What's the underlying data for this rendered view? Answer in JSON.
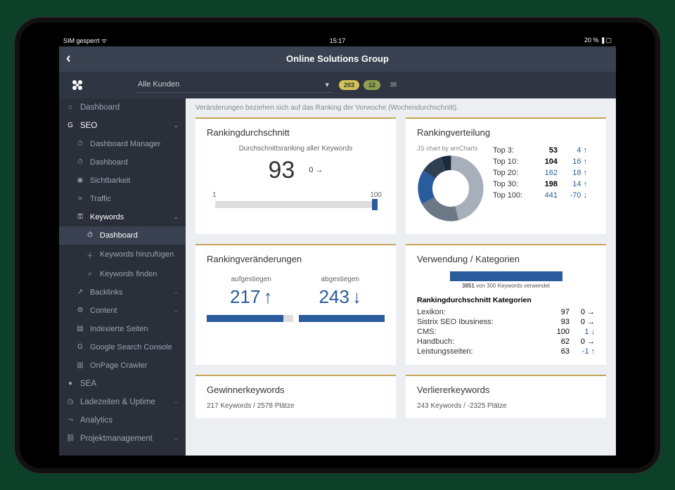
{
  "status": {
    "left": "SIM gesperrt ᯤ",
    "time": "15:17",
    "right": "20 % ❚▢"
  },
  "app_title": "Online Solutions Group",
  "customer_selector": "Alle Kunden",
  "badges": {
    "a": "203",
    "b": "12"
  },
  "sidebar": {
    "dashboard": "Dashboard",
    "seo": "SEO",
    "seo_items": {
      "dash_mgr": "Dashboard Manager",
      "dash": "Dashboard",
      "visibility": "Sichtbarkeit",
      "traffic": "Traffic",
      "keywords": "Keywords",
      "kw_dash": "Dashboard",
      "kw_add": "Keywords hinzufügen",
      "kw_find": "Keywords finden",
      "backlinks": "Backlinks",
      "content": "Content",
      "indexed": "Indexierte Seiten",
      "gsc": "Google Search Console",
      "onpage": "OnPage Crawler"
    },
    "sea": "SEA",
    "uptime": "Ladezeiten & Uptime",
    "analytics": "Analytics",
    "pm": "Projektmanagement"
  },
  "note": "Veränderungen beziehen sich auf das Ranking der Vorwoche (Wochendurchschnitt).",
  "cards": {
    "avg": {
      "title": "Rankingdurchschnitt",
      "subtitle": "Durchschnittsranking aller Keywords",
      "value": "93",
      "delta": "0 →",
      "min": "1",
      "max": "100"
    },
    "dist": {
      "title": "Rankingverteilung",
      "credit": "JS chart by amCharts",
      "rows": [
        {
          "label": "Top 3:",
          "value": "53",
          "delta": "4 ↑",
          "link": false
        },
        {
          "label": "Top 10:",
          "value": "104",
          "delta": "16 ↑",
          "link": false
        },
        {
          "label": "Top 20:",
          "value": "162",
          "delta": "18 ↑",
          "link": true
        },
        {
          "label": "Top 30:",
          "value": "198",
          "delta": "14 ↑",
          "link": false
        },
        {
          "label": "Top 100:",
          "value": "441",
          "delta": "-70 ↓",
          "link": true
        }
      ]
    },
    "changes": {
      "title": "Rankingveränderungen",
      "up_label": "aufgestiegen",
      "up_value": "217",
      "down_label": "abgestiegen",
      "down_value": "243"
    },
    "usage": {
      "title": "Verwendung / Kategorien",
      "bar_bold": "3851",
      "bar_rest": " von 300 Keywords verwendet",
      "cat_title": "Rankingdurchschnitt Kategorien",
      "rows": [
        {
          "label": "Lexikon:",
          "v": "97",
          "d": "0 →"
        },
        {
          "label": "Sistrix SEO Ibusiness:",
          "v": "93",
          "d": "0 →"
        },
        {
          "label": "CMS:",
          "v": "100",
          "d": "1 ↓"
        },
        {
          "label": "Handbuch:",
          "v": "62",
          "d": "0 →"
        },
        {
          "label": "Leistungsseiten:",
          "v": "63",
          "d": "-1 ↑"
        }
      ]
    },
    "winners": {
      "title": "Gewinnerkeywords",
      "sub": "217 Keywords / 2578 Plätze"
    },
    "losers": {
      "title": "Verliererkeywords",
      "sub": "243 Keywords / -2325 Plätze"
    }
  },
  "chart_data": {
    "ranking_avg": {
      "type": "bar",
      "value": 93,
      "range": [
        1,
        100
      ],
      "delta": 0,
      "title": "Durchschnittsranking aller Keywords"
    },
    "ranking_dist": {
      "type": "pie",
      "categories": [
        "Top 3",
        "Top 10",
        "Top 20",
        "Top 30",
        "Top 100"
      ],
      "values": [
        53,
        104,
        162,
        198,
        441
      ],
      "deltas": [
        4,
        16,
        18,
        14,
        -70
      ],
      "colors": [
        "#1c2a3a",
        "#2f3f52",
        "#2a5b9c",
        "#6d7886",
        "#a7afba"
      ],
      "title": "Rankingverteilung"
    },
    "ranking_changes": {
      "type": "bar",
      "categories": [
        "aufgestiegen",
        "abgestiegen"
      ],
      "values": [
        217,
        243
      ]
    },
    "category_avg": {
      "type": "table",
      "rows": [
        {
          "name": "Lexikon",
          "avg": 97,
          "delta": 0
        },
        {
          "name": "Sistrix SEO Ibusiness",
          "avg": 93,
          "delta": 0
        },
        {
          "name": "CMS",
          "avg": 100,
          "delta": 1
        },
        {
          "name": "Handbuch",
          "avg": 62,
          "delta": 0
        },
        {
          "name": "Leistungsseiten",
          "avg": 63,
          "delta": -1
        }
      ]
    }
  }
}
